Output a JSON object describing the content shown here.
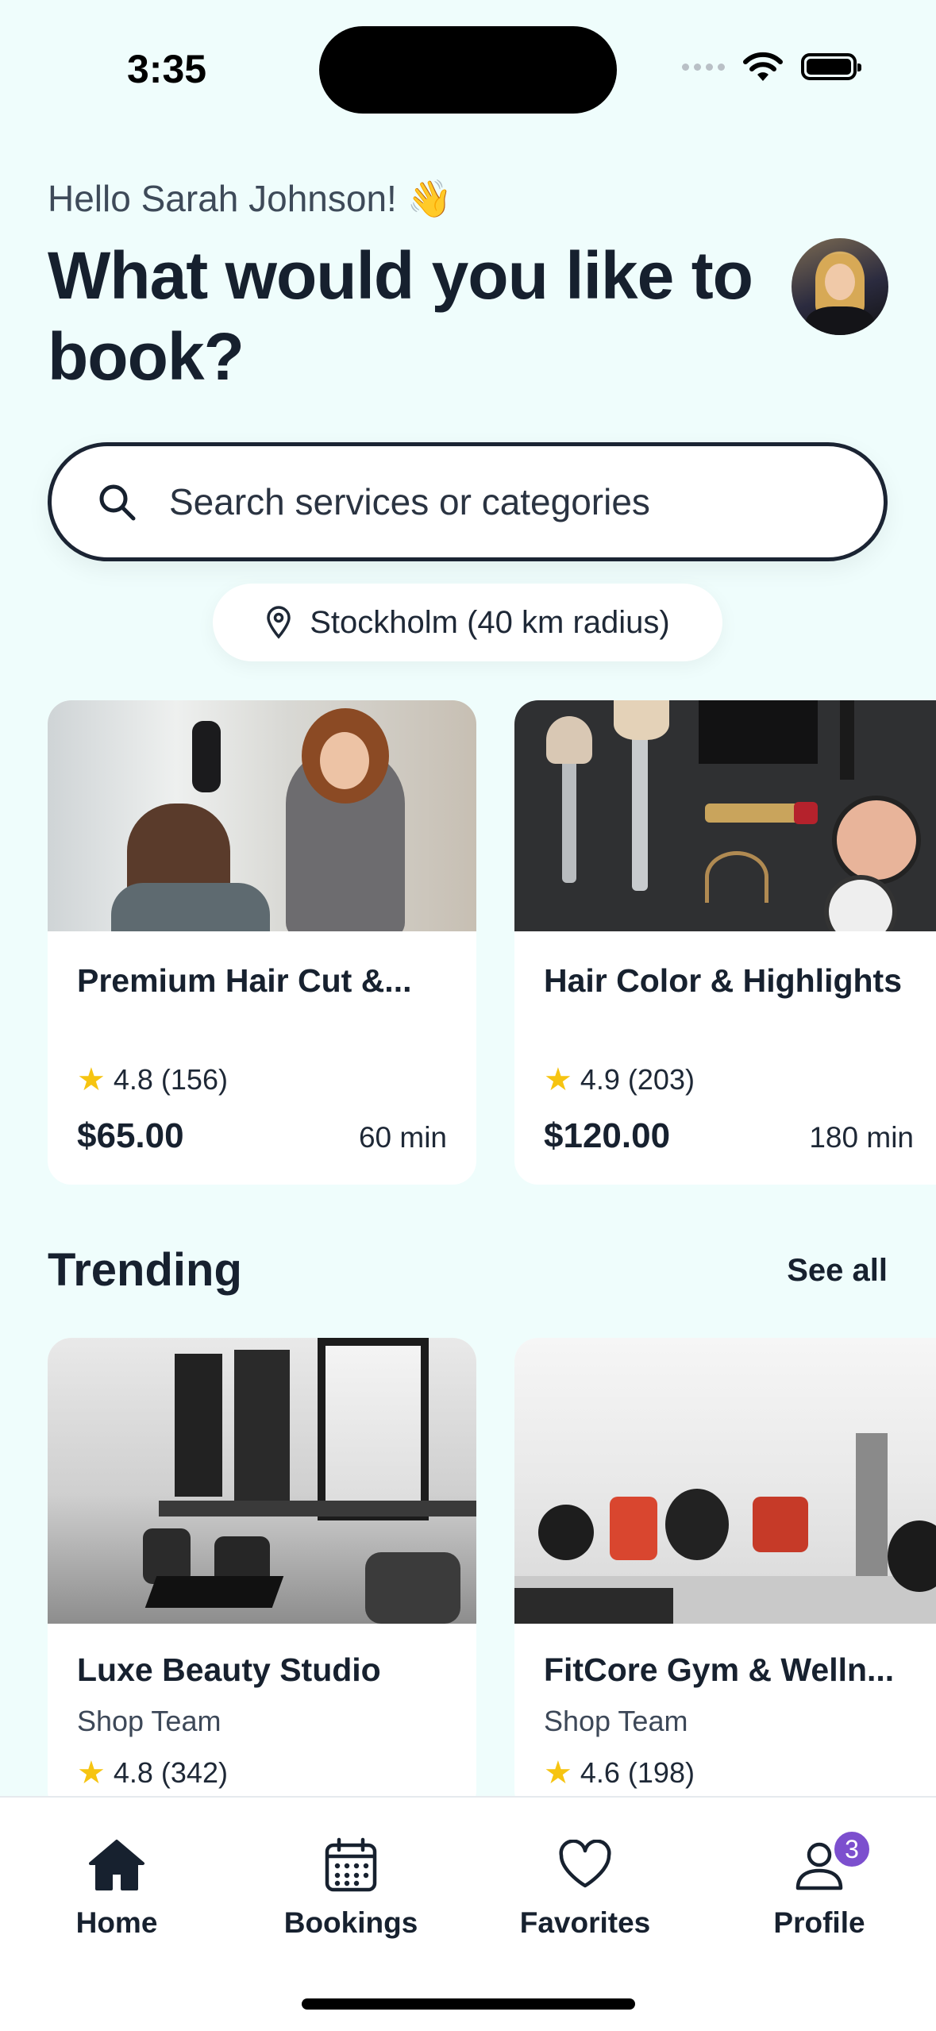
{
  "status": {
    "time": "3:35"
  },
  "header": {
    "greeting": "Hello Sarah Johnson! 👋",
    "title": "What would you like to book?"
  },
  "search": {
    "placeholder": "Search services or categories"
  },
  "location": {
    "label": "Stockholm (40 km radius)"
  },
  "services": [
    {
      "name": "Premium Hair Cut &...",
      "rating": "4.8",
      "reviews": "(156)",
      "price": "$65.00",
      "duration": "60 min"
    },
    {
      "name": "Hair Color & Highlights",
      "rating": "4.9",
      "reviews": "(203)",
      "price": "$120.00",
      "duration": "180 min"
    }
  ],
  "trending": {
    "title": "Trending",
    "see_all": "See all",
    "items": [
      {
        "name": "Luxe Beauty Studio",
        "subtitle": "Shop Team",
        "rating": "4.8",
        "reviews": "(342)"
      },
      {
        "name": "FitCore Gym & Welln...",
        "subtitle": "Shop Team",
        "rating": "4.6",
        "reviews": "(198)"
      }
    ]
  },
  "tabs": {
    "home": "Home",
    "bookings": "Bookings",
    "favorites": "Favorites",
    "profile": "Profile",
    "profile_badge": "3"
  },
  "colors": {
    "background": "#effdfc",
    "accent_badge": "#7c4fce",
    "star": "#f6c411",
    "text": "#16202e"
  }
}
